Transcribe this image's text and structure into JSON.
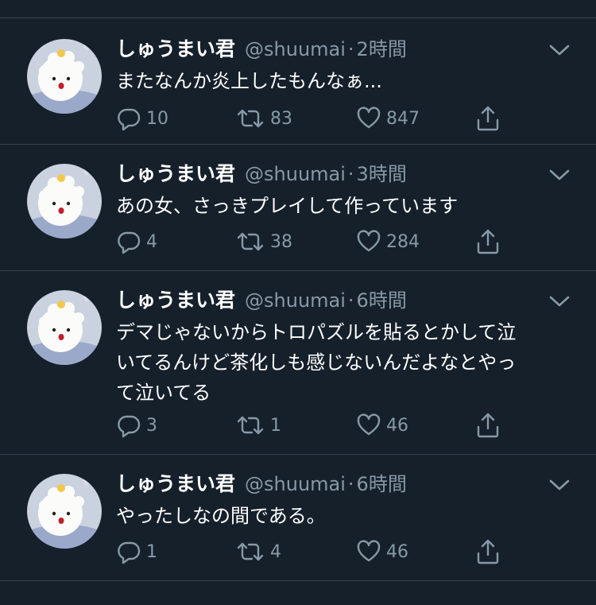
{
  "tweets": [
    {
      "name": "しゅうまい君",
      "handle": "@shuumai",
      "dot": "·",
      "time": "2時間",
      "lines": [
        "またなんか炎上したもんなぁ..."
      ],
      "replies": "10",
      "retweets": "83",
      "likes": "847"
    },
    {
      "name": "しゅうまい君",
      "handle": "@shuumai",
      "dot": "·",
      "time": "3時間",
      "lines": [
        "あの女、さっきプレイして作っています"
      ],
      "replies": "4",
      "retweets": "38",
      "likes": "284"
    },
    {
      "name": "しゅうまい君",
      "handle": "@shuumai",
      "dot": "·",
      "time": "6時間",
      "lines": [
        "デマじゃないからトロパズルを貼るとかして泣",
        "いてるんけど茶化しも感じないんだよなとやっ",
        "て泣いてる"
      ],
      "replies": "3",
      "retweets": "1",
      "likes": "46"
    },
    {
      "name": "しゅうまい君",
      "handle": "@shuumai",
      "dot": "·",
      "time": "6時間",
      "lines": [
        "やったしなの間である。"
      ],
      "replies": "1",
      "retweets": "4",
      "likes": "46"
    }
  ],
  "icons": {
    "reply": "reply-icon",
    "retweet": "retweet-icon",
    "like": "heart-icon",
    "share": "share-icon",
    "menu": "chevron-down-icon",
    "avatar": "shumai-avatar"
  },
  "colors": {
    "background": "#15202b",
    "divider": "#38444d",
    "muted": "#8899a6",
    "text": "#ffffff"
  }
}
